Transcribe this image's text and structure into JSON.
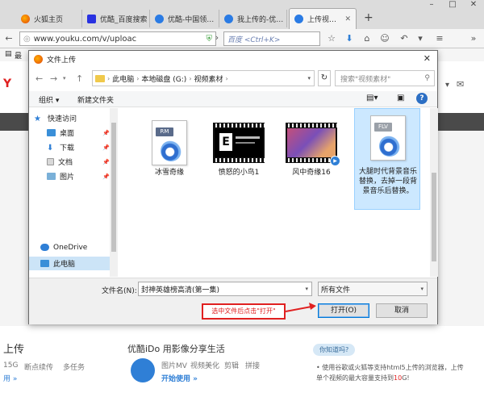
{
  "browser": {
    "tabs": [
      {
        "label": "火狐主页",
        "icon": "firefox-icon",
        "color": "#e66000"
      },
      {
        "label": "优酷_百度搜索",
        "icon": "baidu-paw-icon",
        "color": "#2932e1"
      },
      {
        "label": "优酷-中国领…",
        "icon": "youku-icon",
        "color": "#2a7be4"
      },
      {
        "label": "我上传的-优…",
        "icon": "youku-icon",
        "color": "#2a7be4"
      },
      {
        "label": "上传视…",
        "icon": "youku-icon",
        "color": "#2a7be4"
      }
    ],
    "url": "www.youku.com/v/uploac",
    "search_placeholder": "百度 <Ctrl+K>",
    "bookmark_label": "最"
  },
  "page": {
    "left_heading": "上传",
    "left_links": [
      "15G",
      "断点续传",
      "多任务"
    ],
    "left_link_more": "用 »",
    "ido_title": "优酷iDo 用影像分享生活",
    "ido_features": [
      "图片MV",
      "视频美化",
      "剪辑",
      "拼接"
    ],
    "ido_cta": "开始使用 »",
    "tip_badge": "你知道吗?",
    "tip_lines": [
      "• 使用谷歌或火狐等支持html5上传的浏览器，上传",
      "单个视频的最大容量支持到",
      "G!"
    ],
    "tip_strong": "10"
  },
  "dialog": {
    "title": "文件上传",
    "breadcrumbs": [
      "此电脑",
      "本地磁盘 (G:)",
      "视频素材"
    ],
    "search_placeholder": "搜索\"视频素材\"",
    "organize_label": "组织 ▾",
    "new_folder_label": "新建文件夹",
    "nav_items": [
      {
        "label": "快速访问",
        "pinned": false
      },
      {
        "label": "桌面",
        "pinned": true
      },
      {
        "label": "下载",
        "pinned": true
      },
      {
        "label": "文档",
        "pinned": true
      },
      {
        "label": "图片",
        "pinned": true
      },
      {
        "label": "OneDrive",
        "pinned": false
      },
      {
        "label": "此电脑",
        "pinned": false
      }
    ],
    "files": [
      {
        "name": "冰雪奇缘",
        "type": "RM"
      },
      {
        "name": "愤怒的小鸟1",
        "type": "video"
      },
      {
        "name": "风中奇缘16",
        "type": "video"
      },
      {
        "name": "大腿时代背景音乐替换，去掉一段背景音乐后替换。",
        "type": "FLV",
        "selected": true
      }
    ],
    "filename_label": "文件名(N):",
    "filename_value": "封神英雄榜高清(第一集)",
    "filetype_value": "所有文件",
    "open_label": "打开(O)",
    "cancel_label": "取消"
  },
  "annotation": {
    "callout_text": "选中文件后点击\"打开\""
  },
  "colors": {
    "selection": "#cce8ff",
    "accent": "#0078d7",
    "callout": "#e02020"
  }
}
